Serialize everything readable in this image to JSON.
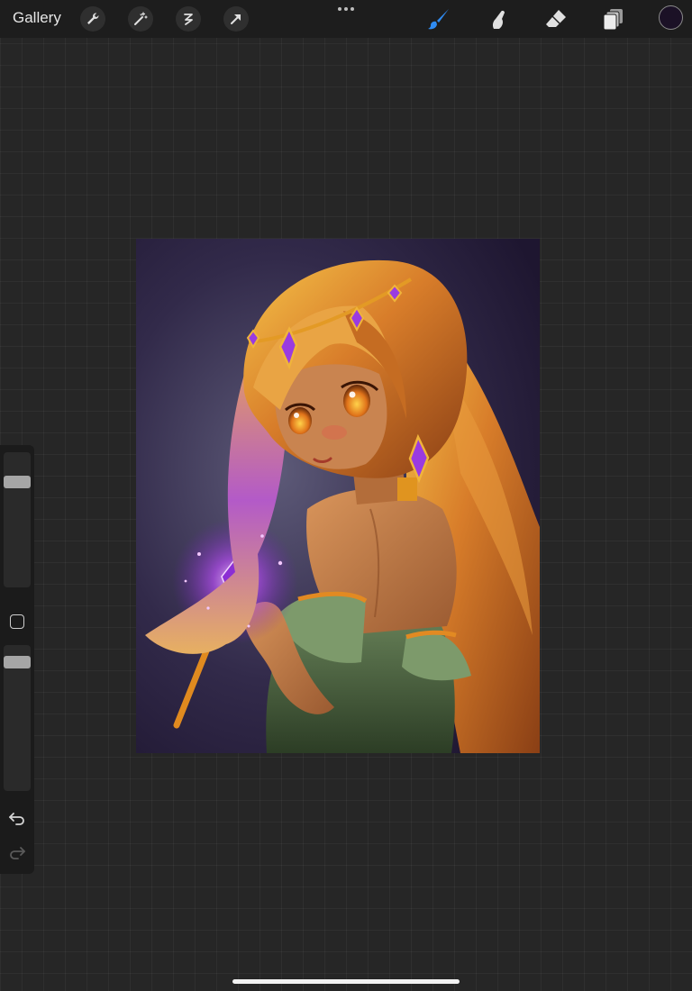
{
  "toolbar": {
    "gallery_label": "Gallery",
    "left_tools": [
      {
        "icon": "wrench-icon"
      },
      {
        "icon": "magic-wand-icon"
      },
      {
        "icon": "selection-icon"
      },
      {
        "icon": "transform-arrow-icon"
      }
    ],
    "more_icon": "more-dots-icon",
    "right_tools": [
      {
        "icon": "brush-icon",
        "active": true,
        "color": "#2f8cf3"
      },
      {
        "icon": "smudge-icon"
      },
      {
        "icon": "eraser-icon"
      },
      {
        "icon": "layers-icon"
      }
    ],
    "current_color": "#1b1126"
  },
  "sidebar": {
    "brush_size_icon": "brush-size-slider",
    "modify_icon": "modify-button-icon",
    "opacity_icon": "opacity-slider",
    "undo_icon": "undo-icon",
    "redo_icon": "redo-icon"
  },
  "canvas": {
    "artwork": "anime-girl-illustration",
    "background_color": "#2b2540"
  }
}
